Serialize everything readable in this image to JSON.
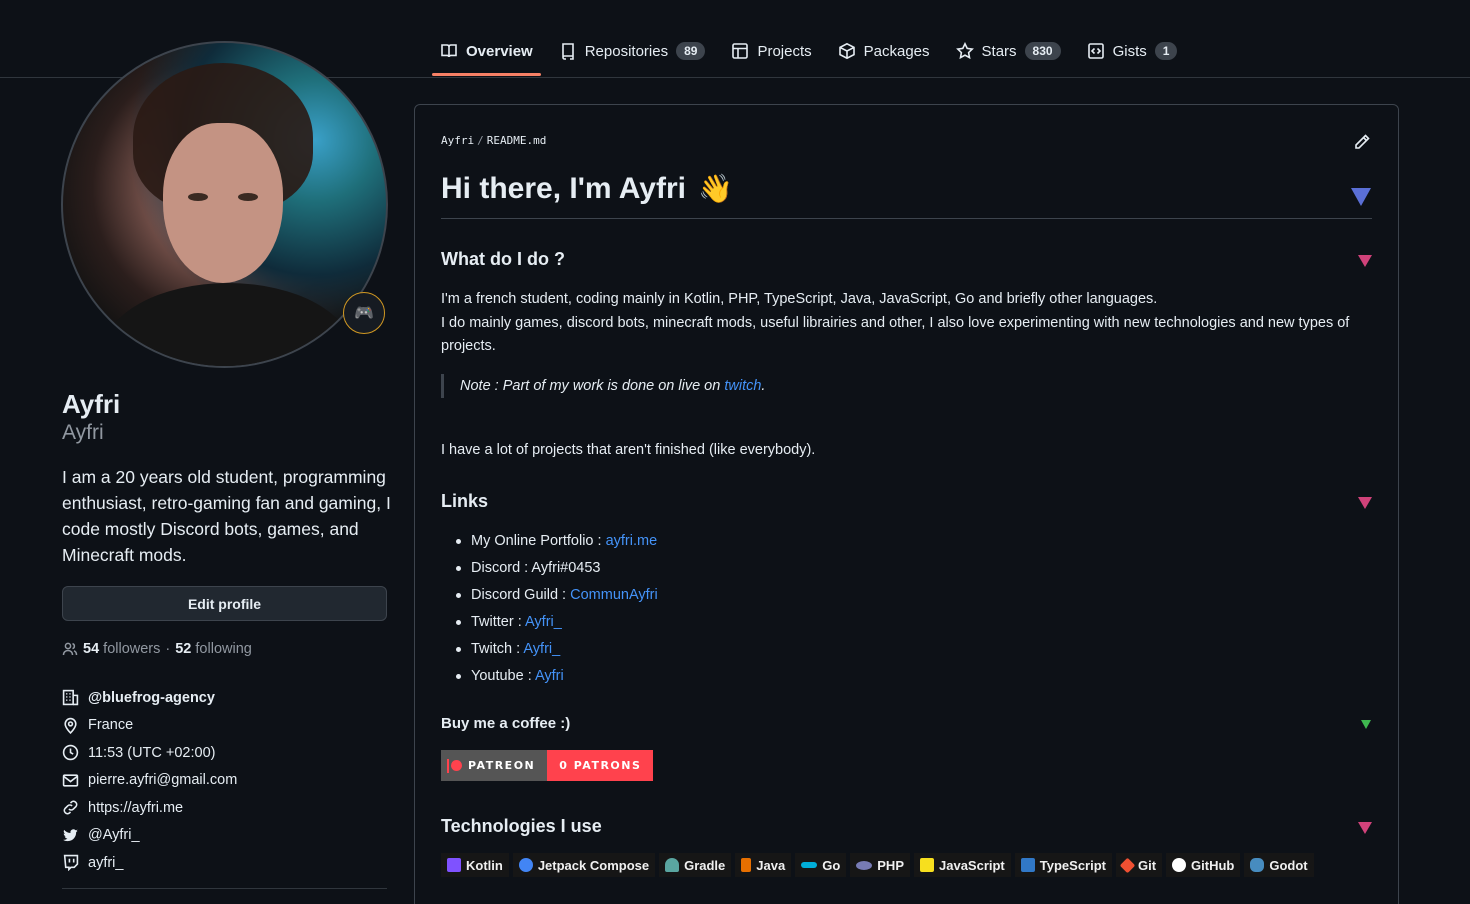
{
  "nav": {
    "tabs": [
      {
        "label": "Overview",
        "count": null,
        "icon": "book-icon",
        "active": true
      },
      {
        "label": "Repositories",
        "count": "89",
        "icon": "repo-icon"
      },
      {
        "label": "Projects",
        "count": null,
        "icon": "table-icon"
      },
      {
        "label": "Packages",
        "count": null,
        "icon": "package-icon"
      },
      {
        "label": "Stars",
        "count": "830",
        "icon": "star-icon"
      },
      {
        "label": "Gists",
        "count": "1",
        "icon": "code-square-icon"
      }
    ]
  },
  "profile": {
    "name": "Ayfri",
    "login": "Ayfri",
    "bio": "I am a 20 years old student, programming enthusiast, retro-gaming fan and gaming, I code mostly Discord bots, games, and Minecraft mods.",
    "status_emoji": "🎮",
    "edit_label": "Edit profile",
    "followers": "54",
    "followers_label": "followers",
    "following": "52",
    "following_label": "following",
    "separator": "·",
    "organization": "@bluefrog-agency",
    "location": "France",
    "local_time": "11:53 (UTC +02:00)",
    "email": "pierre.ayfri@gmail.com",
    "website": "https://ayfri.me",
    "twitter": "@Ayfri_",
    "twitch": "ayfri_"
  },
  "readme": {
    "crumb_owner": "Ayfri",
    "crumb_slash": "/",
    "crumb_file": "README.md",
    "title": "Hi there, I'm Ayfri",
    "title_emoji": "👋",
    "what_heading": "What do I do ?",
    "what_line1": "I'm a french student, coding mainly in Kotlin, PHP, TypeScript, Java, JavaScript, Go and briefly other languages.",
    "what_line2": "I do mainly games, discord bots, minecraft mods, useful librairies and other, I also love experimenting with new technologies and new types of projects.",
    "note_prefix": "Note : Part of my work is done on live on ",
    "note_link": "twitch",
    "note_suffix": ".",
    "unfinished": "I have a lot of projects that aren't finished (like everybody).",
    "links_heading": "Links",
    "links": [
      {
        "label": "My Online Portfolio : ",
        "value": "ayfri.me",
        "is_link": true
      },
      {
        "label": "Discord : Ayfri#0453",
        "value": "",
        "is_link": false
      },
      {
        "label": "Discord Guild : ",
        "value": "CommunAyfri",
        "is_link": true
      },
      {
        "label": "Twitter : ",
        "value": "Ayfri_",
        "is_link": true
      },
      {
        "label": "Twitch : ",
        "value": "Ayfri_",
        "is_link": true
      },
      {
        "label": "Youtube : ",
        "value": "Ayfri",
        "is_link": true
      }
    ],
    "coffee_heading": "Buy me a coffee :)",
    "patreon_left": "PATREON",
    "patreon_right": "0 PATRONS",
    "tech_heading": "Technologies I use",
    "technologies": [
      {
        "label": "Kotlin",
        "color": "#7f52ff"
      },
      {
        "label": "Jetpack Compose",
        "color": "#4285f4"
      },
      {
        "label": "Gradle",
        "color": "#5aa5a0"
      },
      {
        "label": "Java",
        "color": "#e76f00"
      },
      {
        "label": "Go",
        "color": "#00add8"
      },
      {
        "label": "PHP",
        "color": "#777bb4"
      },
      {
        "label": "JavaScript",
        "color": "#f7df1e"
      },
      {
        "label": "TypeScript",
        "color": "#3178c6"
      },
      {
        "label": "Git",
        "color": "#f05032"
      },
      {
        "label": "GitHub",
        "color": "#ffffff"
      },
      {
        "label": "Godot",
        "color": "#478cbf"
      }
    ]
  },
  "colors": {
    "accent_underline": "#f78166",
    "link": "#4493f8",
    "section_marker_pink": "#d0427a",
    "section_marker_blue": "#5a6fd6",
    "section_marker_green": "#3fb950",
    "patreon_red": "#ff424d"
  }
}
